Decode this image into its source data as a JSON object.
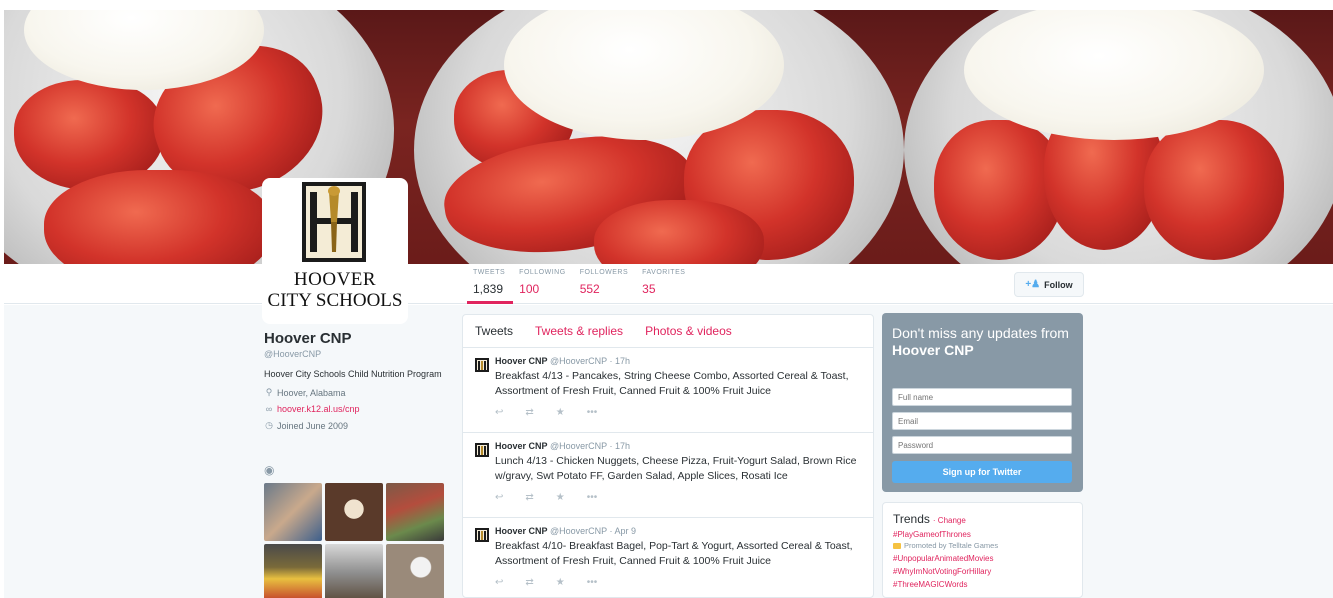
{
  "profile": {
    "logo_line1": "HOOVER",
    "logo_line2": "CITY SCHOOLS",
    "name": "Hoover CNP",
    "handle": "@HooverCNP",
    "bio": "Hoover City Schools Child Nutrition Program",
    "location": "Hoover, Alabama",
    "website": "hoover.k12.al.us/cnp",
    "joined": "Joined June 2009",
    "icons": {
      "location": "map-pin-icon",
      "link": "link-icon",
      "calendar": "calendar-icon",
      "camera": "camera-icon"
    }
  },
  "stats": [
    {
      "label": "TWEETS",
      "value": "1,839"
    },
    {
      "label": "FOLLOWING",
      "value": "100"
    },
    {
      "label": "FOLLOWERS",
      "value": "552"
    },
    {
      "label": "FAVORITES",
      "value": "35"
    }
  ],
  "follow_button": {
    "label": "Follow",
    "icon": "add-user-icon"
  },
  "tabs": [
    {
      "label": "Tweets"
    },
    {
      "label": "Tweets & replies"
    },
    {
      "label": "Photos & videos"
    }
  ],
  "tweets": [
    {
      "author": "Hoover CNP",
      "handle": "@HooverCNP",
      "time": "17h",
      "text": "Breakfast 4/13 - Pancakes, String Cheese Combo, Assorted Cereal & Toast, Assortment of Fresh Fruit, Canned Fruit & 100% Fruit Juice"
    },
    {
      "author": "Hoover CNP",
      "handle": "@HooverCNP",
      "time": "17h",
      "text": "Lunch 4/13 - Chicken Nuggets, Cheese Pizza, Fruit-Yogurt Salad, Brown Rice w/gravy, Swt Potato FF, Garden Salad, Apple Slices, Rosati Ice"
    },
    {
      "author": "Hoover CNP",
      "handle": "@HooverCNP",
      "time": "Apr 9",
      "text": "Breakfast 4/10- Breakfast Bagel, Pop-Tart & Yogurt, Assorted Cereal & Toast, Assortment of Fresh Fruit, Canned Fruit & 100% Fruit Juice"
    }
  ],
  "tweet_actions": {
    "reply": "↩",
    "retweet": "⇄",
    "favorite": "★",
    "more": "•••"
  },
  "signup": {
    "headline_prefix": "Don't miss any updates from ",
    "headline_name": "Hoover CNP",
    "fullname_placeholder": "Full name",
    "email_placeholder": "Email",
    "password_placeholder": "Password",
    "button": "Sign up for Twitter"
  },
  "trends": {
    "title": "Trends",
    "change": "· Change",
    "items": [
      "#PlayGameofThrones",
      "#UnpopularAnimatedMovies",
      "#WhyImNotVotingForHillary",
      "#ThreeMAGICWords"
    ],
    "promoted": "Promoted by Telltale Games"
  },
  "colors": {
    "accent": "#e0245e",
    "twitter_blue": "#55acee",
    "signup_panel": "#8899a6",
    "page_bg": "#f5f8fa"
  }
}
